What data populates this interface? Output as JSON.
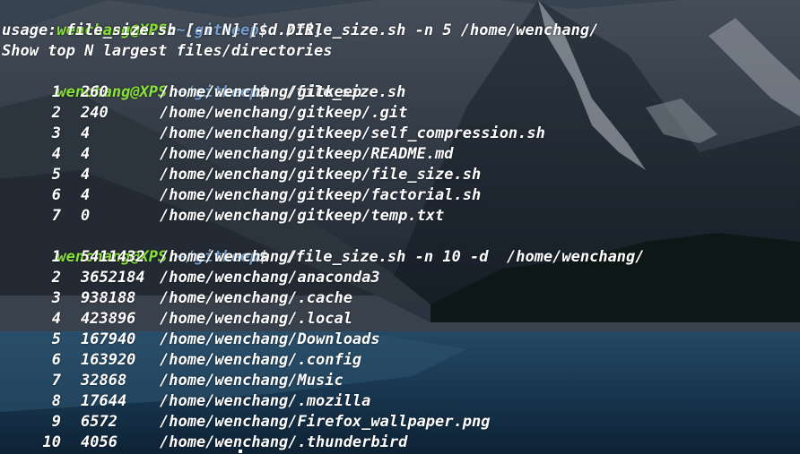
{
  "prompt": {
    "user_host": "wenchang@XPS",
    "sep": ":",
    "cwd": "~/gitkeep",
    "symbol": "$"
  },
  "commands": {
    "first": " ./file_size.sh -n 5 /home/wenchang/",
    "second": " ./file_size.sh",
    "third": " ./file_size.sh -n 10 -d  /home/wenchang/"
  },
  "usage": {
    "line1": "usage: file_size.sh [-n N] [-d DIR]",
    "line2": "Show top N largest files/directories"
  },
  "results_gitkeep": [
    {
      "index": "1",
      "size": "260",
      "path": "/home/wenchang/gitkeep"
    },
    {
      "index": "2",
      "size": "240",
      "path": "/home/wenchang/gitkeep/.git"
    },
    {
      "index": "3",
      "size": "4",
      "path": "/home/wenchang/gitkeep/self_compression.sh"
    },
    {
      "index": "4",
      "size": "4",
      "path": "/home/wenchang/gitkeep/README.md"
    },
    {
      "index": "5",
      "size": "4",
      "path": "/home/wenchang/gitkeep/file_size.sh"
    },
    {
      "index": "6",
      "size": "4",
      "path": "/home/wenchang/gitkeep/factorial.sh"
    },
    {
      "index": "7",
      "size": "0",
      "path": "/home/wenchang/gitkeep/temp.txt"
    }
  ],
  "results_home": [
    {
      "index": "1",
      "size": "5411432",
      "path": "/home/wenchang/"
    },
    {
      "index": "2",
      "size": "3652184",
      "path": "/home/wenchang/anaconda3"
    },
    {
      "index": "3",
      "size": "938188",
      "path": "/home/wenchang/.cache"
    },
    {
      "index": "4",
      "size": "423896",
      "path": "/home/wenchang/.local"
    },
    {
      "index": "5",
      "size": "167940",
      "path": "/home/wenchang/Downloads"
    },
    {
      "index": "6",
      "size": "163920",
      "path": "/home/wenchang/.config"
    },
    {
      "index": "7",
      "size": "32868",
      "path": "/home/wenchang/Music"
    },
    {
      "index": "8",
      "size": "17644",
      "path": "/home/wenchang/.mozilla"
    },
    {
      "index": "9",
      "size": "6572",
      "path": "/home/wenchang/Firefox_wallpaper.png"
    },
    {
      "index": "10",
      "size": "4056",
      "path": "/home/wenchang/.thunderbird"
    }
  ],
  "colors": {
    "user_host": "#8ae234",
    "cwd": "#729fcf",
    "text": "#ffffff"
  },
  "icons": {
    "wallpaper": "mountain-lake-wallpaper",
    "cursor": "terminal-cursor"
  }
}
